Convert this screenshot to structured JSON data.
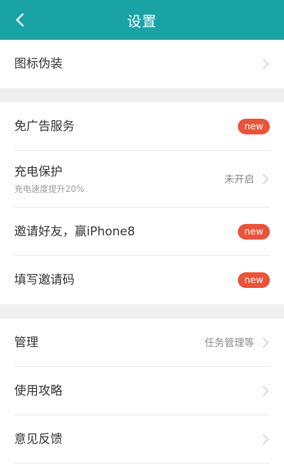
{
  "header": {
    "title": "设置",
    "back_icon": "chevron-left-icon"
  },
  "colors": {
    "header_bg": "#1aa3a4",
    "badge_bg": "#e8533a",
    "gap_bg": "#efefef"
  },
  "groups": [
    {
      "items": [
        {
          "label": "图标伪装",
          "icon": "chevron-right-icon"
        }
      ]
    },
    {
      "items": [
        {
          "label": "免广告服务",
          "badge": "new"
        },
        {
          "label": "充电保护",
          "sublabel": "充电速度提升20%",
          "value": "未开启",
          "icon": "chevron-right-icon"
        },
        {
          "label": "邀请好友，赢iPhone8",
          "badge": "new"
        },
        {
          "label": "填写邀请码",
          "badge": "new"
        }
      ]
    },
    {
      "items": [
        {
          "label": "管理",
          "value": "任务管理等",
          "icon": "chevron-right-icon"
        },
        {
          "label": "使用攻略",
          "icon": "chevron-right-icon"
        },
        {
          "label": "意见反馈",
          "icon": "chevron-right-icon"
        }
      ]
    }
  ]
}
